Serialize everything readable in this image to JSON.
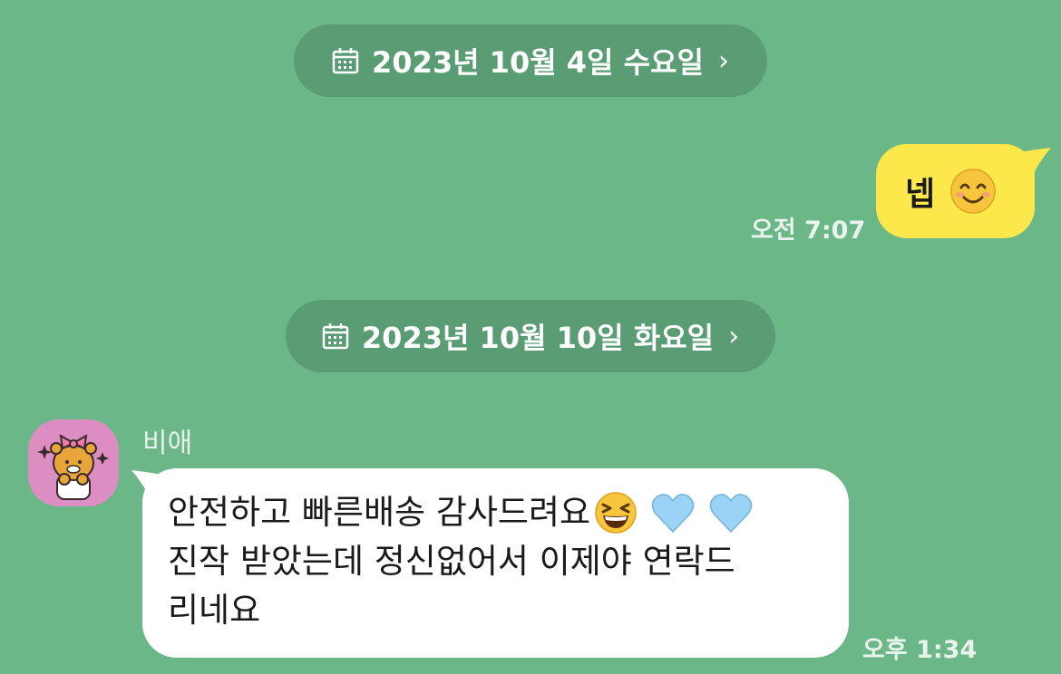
{
  "chat": {
    "date_dividers": [
      {
        "label": "2023년 10월 4일 수요일",
        "chevron": "›"
      },
      {
        "label": "2023년 10월 10일 화요일",
        "chevron": "›"
      }
    ],
    "messages": [
      {
        "from": "me",
        "text": "넵",
        "emoji": "smiling-face-icon",
        "time": "오전 7:07"
      },
      {
        "from": "other",
        "sender": "비애",
        "lines": [
          "안전하고 빠른배송 감사드려요",
          "진작 받았는데 정신없어서 이제야 연락드",
          "리네요"
        ],
        "emojis": [
          "grinning-squinting-face-icon",
          "light-blue-heart-icon",
          "light-blue-heart-icon"
        ],
        "time": "오후 1:34"
      }
    ]
  },
  "colors": {
    "background": "#6BB788",
    "date_pill": "#5A9C73",
    "my_bubble": "#FCE84A",
    "other_bubble": "#FFFFFF",
    "avatar_bg": "#DC8EC3",
    "heart": "#9AD3F5"
  }
}
